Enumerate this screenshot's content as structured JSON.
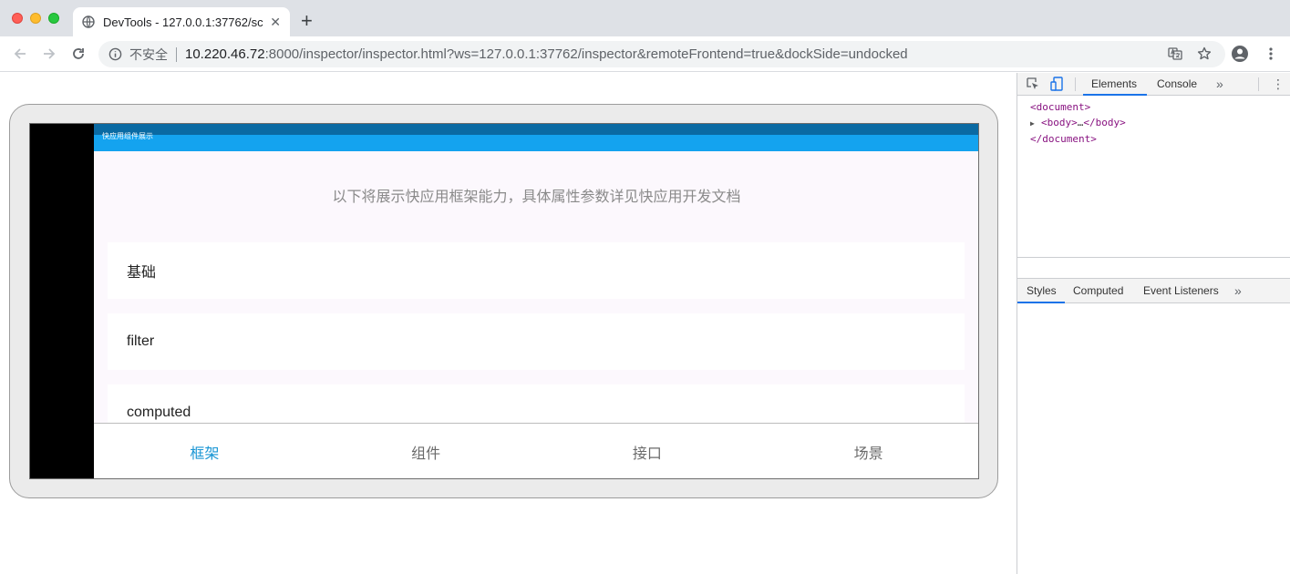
{
  "browser": {
    "tab": {
      "title": "DevTools - 127.0.0.1:37762/sc",
      "close": "✕"
    },
    "new_tab": "+",
    "omnibox": {
      "security_label": "不安全",
      "url_host": "10.220.46.72",
      "url_rest": ":8000/inspector/inspector.html?ws=127.0.0.1:37762/inspector&remoteFrontend=true&dockSide=undocked"
    },
    "icons": [
      "back-arrow-icon",
      "forward-arrow-icon",
      "reload-icon",
      "info-icon",
      "translate-icon",
      "star-icon",
      "profile-icon",
      "menu-icon"
    ]
  },
  "app": {
    "title": "快应用组件展示",
    "intro": "以下将展示快应用框架能力，具体属性参数详见快应用开发文档",
    "menu": [
      "基础",
      "filter",
      "computed"
    ],
    "bottom_tabs": [
      {
        "label": "框架",
        "active": true
      },
      {
        "label": "组件",
        "active": false
      },
      {
        "label": "接口",
        "active": false
      },
      {
        "label": "场景",
        "active": false
      }
    ],
    "colors": {
      "header": "#14a3ef",
      "statusbar": "#0a6aa3",
      "active_tab": "#1a96d4"
    }
  },
  "devtools": {
    "tabs": {
      "elements": "Elements",
      "console": "Console",
      "more": "»",
      "kebab": "⋮"
    },
    "dom": {
      "line1": "<document>",
      "line2_open": "<body>",
      "line2_ellipsis": "…",
      "line2_close": "</body>",
      "line3": "</document>"
    },
    "styles_tabs": {
      "styles": "Styles",
      "computed": "Computed",
      "listeners": "Event Listeners",
      "more": "»"
    },
    "accent": "#1a73e8"
  }
}
